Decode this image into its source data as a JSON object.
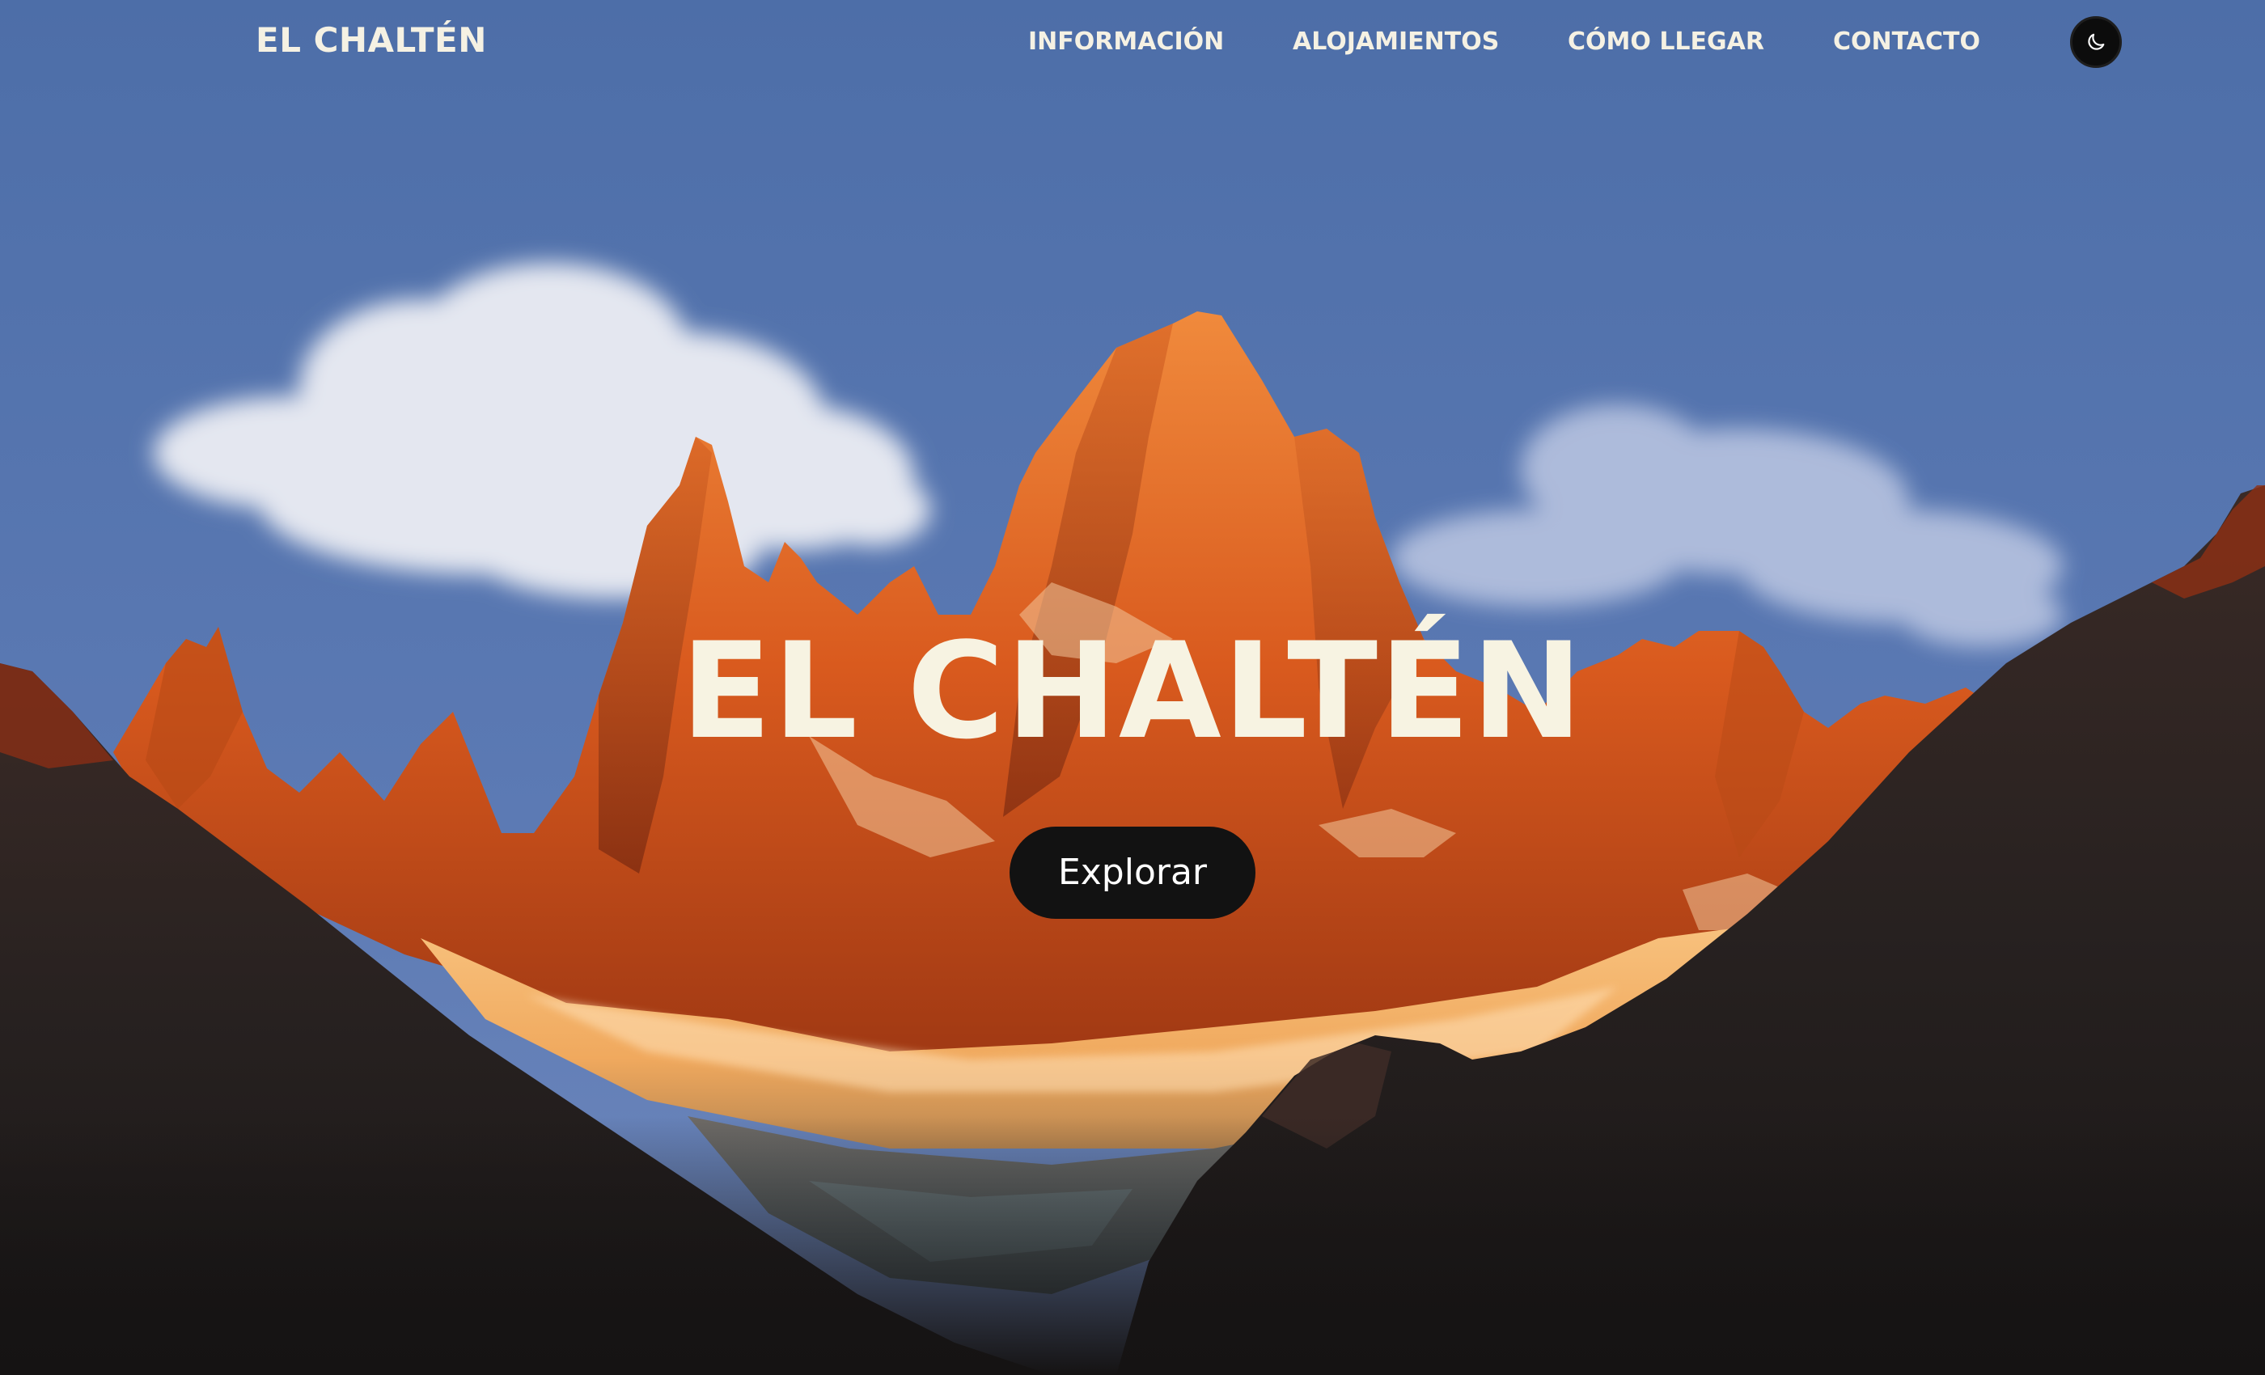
{
  "navbar": {
    "brand": "EL CHALTÉN",
    "links": [
      {
        "label": "INFORMACIÓN"
      },
      {
        "label": "ALOJAMIENTOS"
      },
      {
        "label": "CÓMO LLEGAR"
      },
      {
        "label": "CONTACTO"
      }
    ],
    "theme_toggle_icon": "moon-icon"
  },
  "hero": {
    "title": "EL CHALTÉN",
    "button_label": "Explorar",
    "background": "mountain-landscape"
  },
  "colors": {
    "text_light": "#f5f1e3",
    "sky": "#5574ae",
    "peaks": "#e0661e",
    "button_bg": "#121212"
  }
}
